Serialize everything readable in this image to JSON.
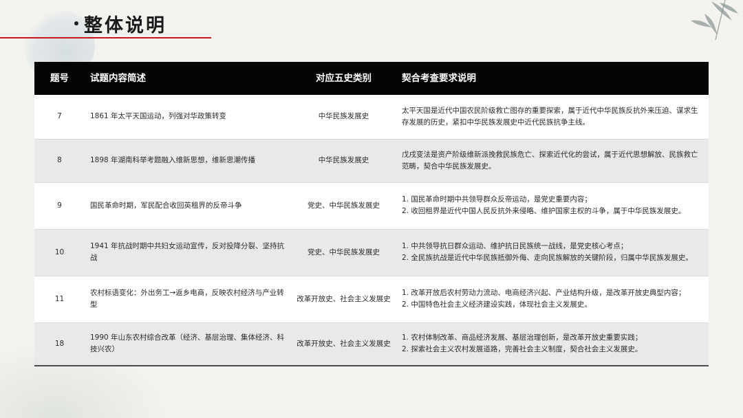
{
  "title": "整体说明",
  "table": {
    "headers": [
      "题号",
      "试题内容简述",
      "对应五史类别",
      "契合考查要求说明"
    ],
    "rows": [
      {
        "num": "7",
        "content": "1861 年太平天国运动，列强对华政策转变",
        "category": "中华民族发展史",
        "lines": [
          "太平天国是近代中国农民阶级救亡图存的重要探索，属于近代中华民族反抗外来压迫、谋求生存发展的历史，紧扣中华民族发展史中近代民族抗争主线。"
        ]
      },
      {
        "num": "8",
        "content": "1898 年湖南科举考题融入维新思想，维新思潮传播",
        "category": "中华民族发展史",
        "lines": [
          "戊戌变法是资产阶级维新派挽救民族危亡、探索近代化的尝试，属于近代思想解放、民族救亡范畴，契合中华民族发展史。"
        ]
      },
      {
        "num": "9",
        "content": "国民革命时期，军民配合收回英租界的反帝斗争",
        "category": "党史、中华民族发展史",
        "lines": [
          "1. 国民革命时期中共领导群众反帝运动，是党史重要内容；",
          "2. 收回租界是近代中国人民反抗外来侵略、维护国家主权的斗争，属于中华民族发展史。"
        ]
      },
      {
        "num": "10",
        "content": "1941 年抗战时期中共妇女运动宣传，反对投降分裂、坚持抗战",
        "category": "党史、中华民族发展史",
        "lines": [
          "1. 中共领导抗日群众运动、维护抗日民族统一战线，是党史核心考点；",
          "2. 全民族抗战是近代中华民族抵御外侮、走向民族解放的关键阶段，归属中华民族发展史。"
        ]
      },
      {
        "num": "11",
        "content": "农村标语变化：外出务工→返乡电商，反映农村经济与产业转型",
        "category": "改革开放史、社会主义发展史",
        "lines": [
          "1. 改革开放后农村劳动力流动、电商经济兴起、产业结构升级，是改革开放史典型内容；",
          "2. 中国特色社会主义经济建设实践，体现社会主义发展史。"
        ]
      },
      {
        "num": "18",
        "content": "1990 年山东农村综合改革（经济、基层治理、集体经济、科技兴农）",
        "category": "改革开放史、社会主义发展史",
        "lines": [
          "1. 农村体制改革、商品经济发展、基层治理创新，是改革开放史重要实践；",
          "2. 探索社会主义农村发展道路，完善社会主义制度，契合社会主义发展史。"
        ]
      }
    ]
  }
}
